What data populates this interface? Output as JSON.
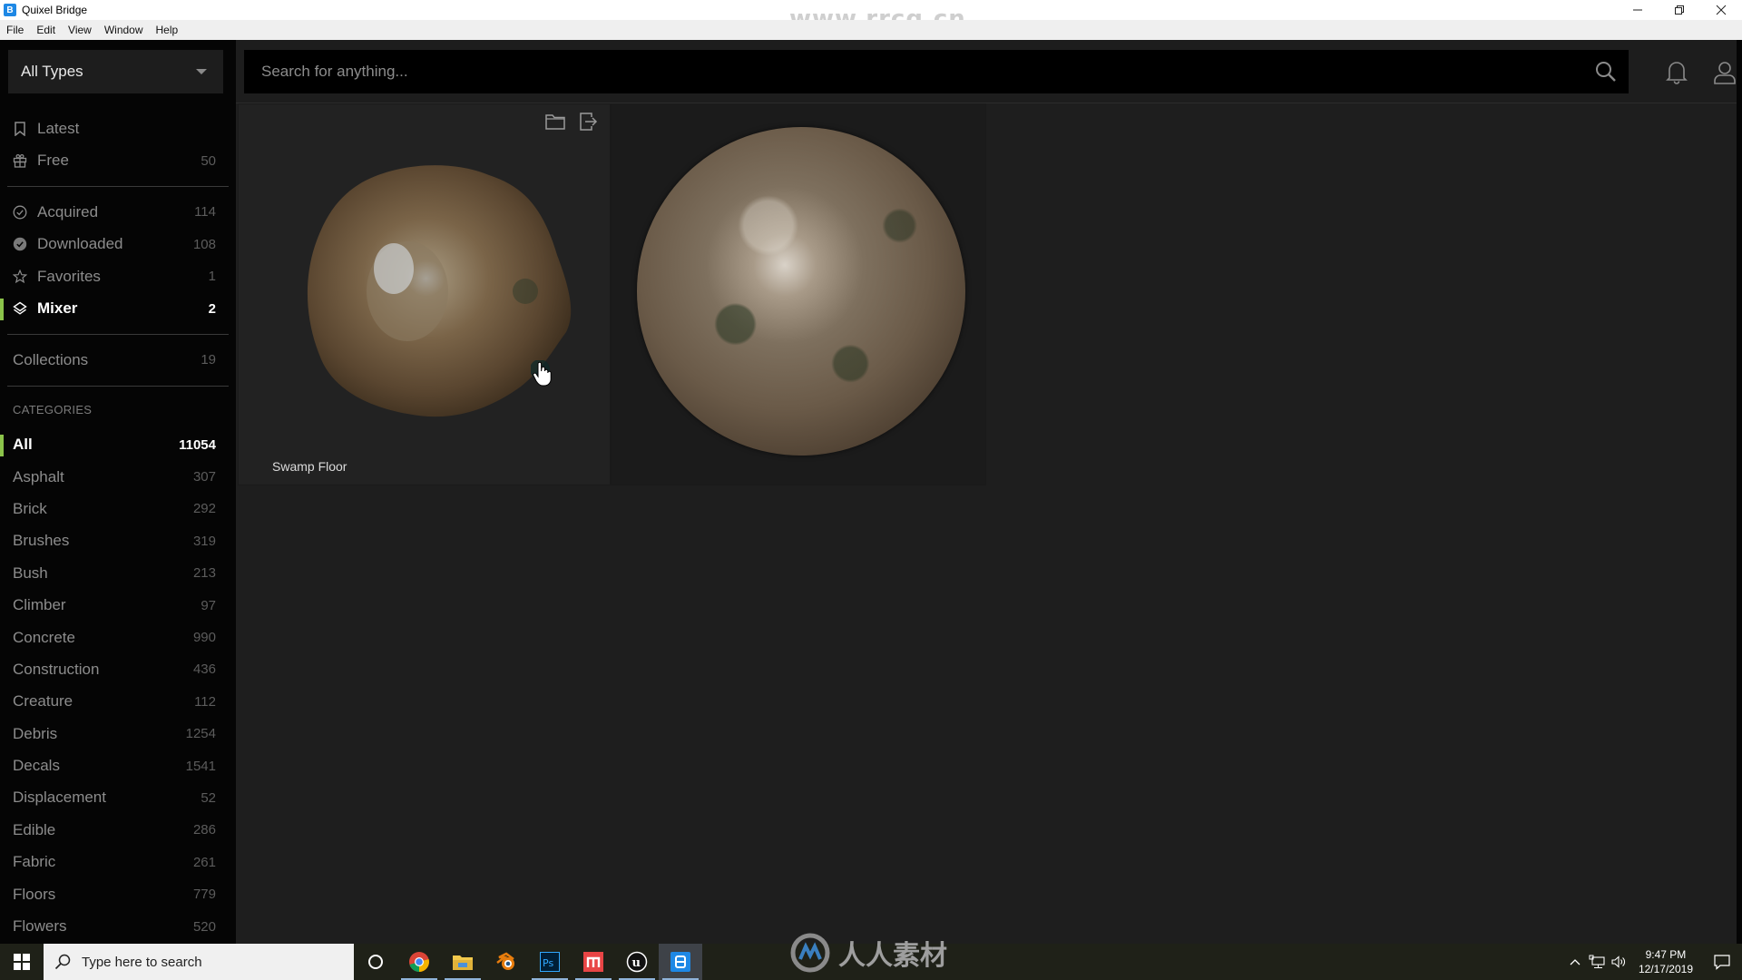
{
  "window": {
    "title": "Quixel Bridge",
    "app_icon_letter": "B",
    "watermark_text": "www.rrcg.cn",
    "controls": {
      "minimize": "minimize",
      "restore": "restore",
      "close": "close"
    }
  },
  "menubar": {
    "items": [
      "File",
      "Edit",
      "View",
      "Window",
      "Help"
    ]
  },
  "sidebar": {
    "type_filter": {
      "selected": "All Types"
    },
    "nav": [
      {
        "label": "Latest",
        "icon": "bookmark-icon",
        "count": ""
      },
      {
        "label": "Free",
        "icon": "gift-icon",
        "count": "50"
      },
      {
        "label": "Acquired",
        "icon": "check-circle-outline-icon",
        "count": "114"
      },
      {
        "label": "Downloaded",
        "icon": "check-circle-filled-icon",
        "count": "108"
      },
      {
        "label": "Favorites",
        "icon": "star-icon",
        "count": "1"
      },
      {
        "label": "Mixer",
        "icon": "layers-icon",
        "count": "2",
        "active": true
      },
      {
        "label": "Collections",
        "count": "19"
      }
    ],
    "categories_header": "CATEGORIES",
    "categories": [
      {
        "label": "All",
        "count": "11054",
        "active": true
      },
      {
        "label": "Asphalt",
        "count": "307"
      },
      {
        "label": "Brick",
        "count": "292"
      },
      {
        "label": "Brushes",
        "count": "319"
      },
      {
        "label": "Bush",
        "count": "213"
      },
      {
        "label": "Climber",
        "count": "97"
      },
      {
        "label": "Concrete",
        "count": "990"
      },
      {
        "label": "Construction",
        "count": "436"
      },
      {
        "label": "Creature",
        "count": "112"
      },
      {
        "label": "Debris",
        "count": "1254"
      },
      {
        "label": "Decals",
        "count": "1541"
      },
      {
        "label": "Displacement",
        "count": "52"
      },
      {
        "label": "Edible",
        "count": "286"
      },
      {
        "label": "Fabric",
        "count": "261"
      },
      {
        "label": "Floors",
        "count": "779"
      },
      {
        "label": "Flowers",
        "count": "520"
      }
    ],
    "accent_color": "#8bc34a"
  },
  "topbar": {
    "search_placeholder": "Search for anything...",
    "search_value": ""
  },
  "assets": [
    {
      "name": "Swamp Floor",
      "preview": "rock-scan",
      "actions": [
        "folder-icon",
        "export-icon"
      ]
    },
    {
      "name": "",
      "preview": "sphere-material"
    }
  ],
  "taskbar": {
    "search_placeholder": "Type here to search",
    "apps": [
      "cortana",
      "chrome",
      "file-explorer",
      "blender",
      "photoshop",
      "mixer",
      "unreal-engine",
      "quixel-bridge"
    ],
    "watermark_text": "人人素材",
    "time": "9:47 PM",
    "date": "12/17/2019"
  }
}
